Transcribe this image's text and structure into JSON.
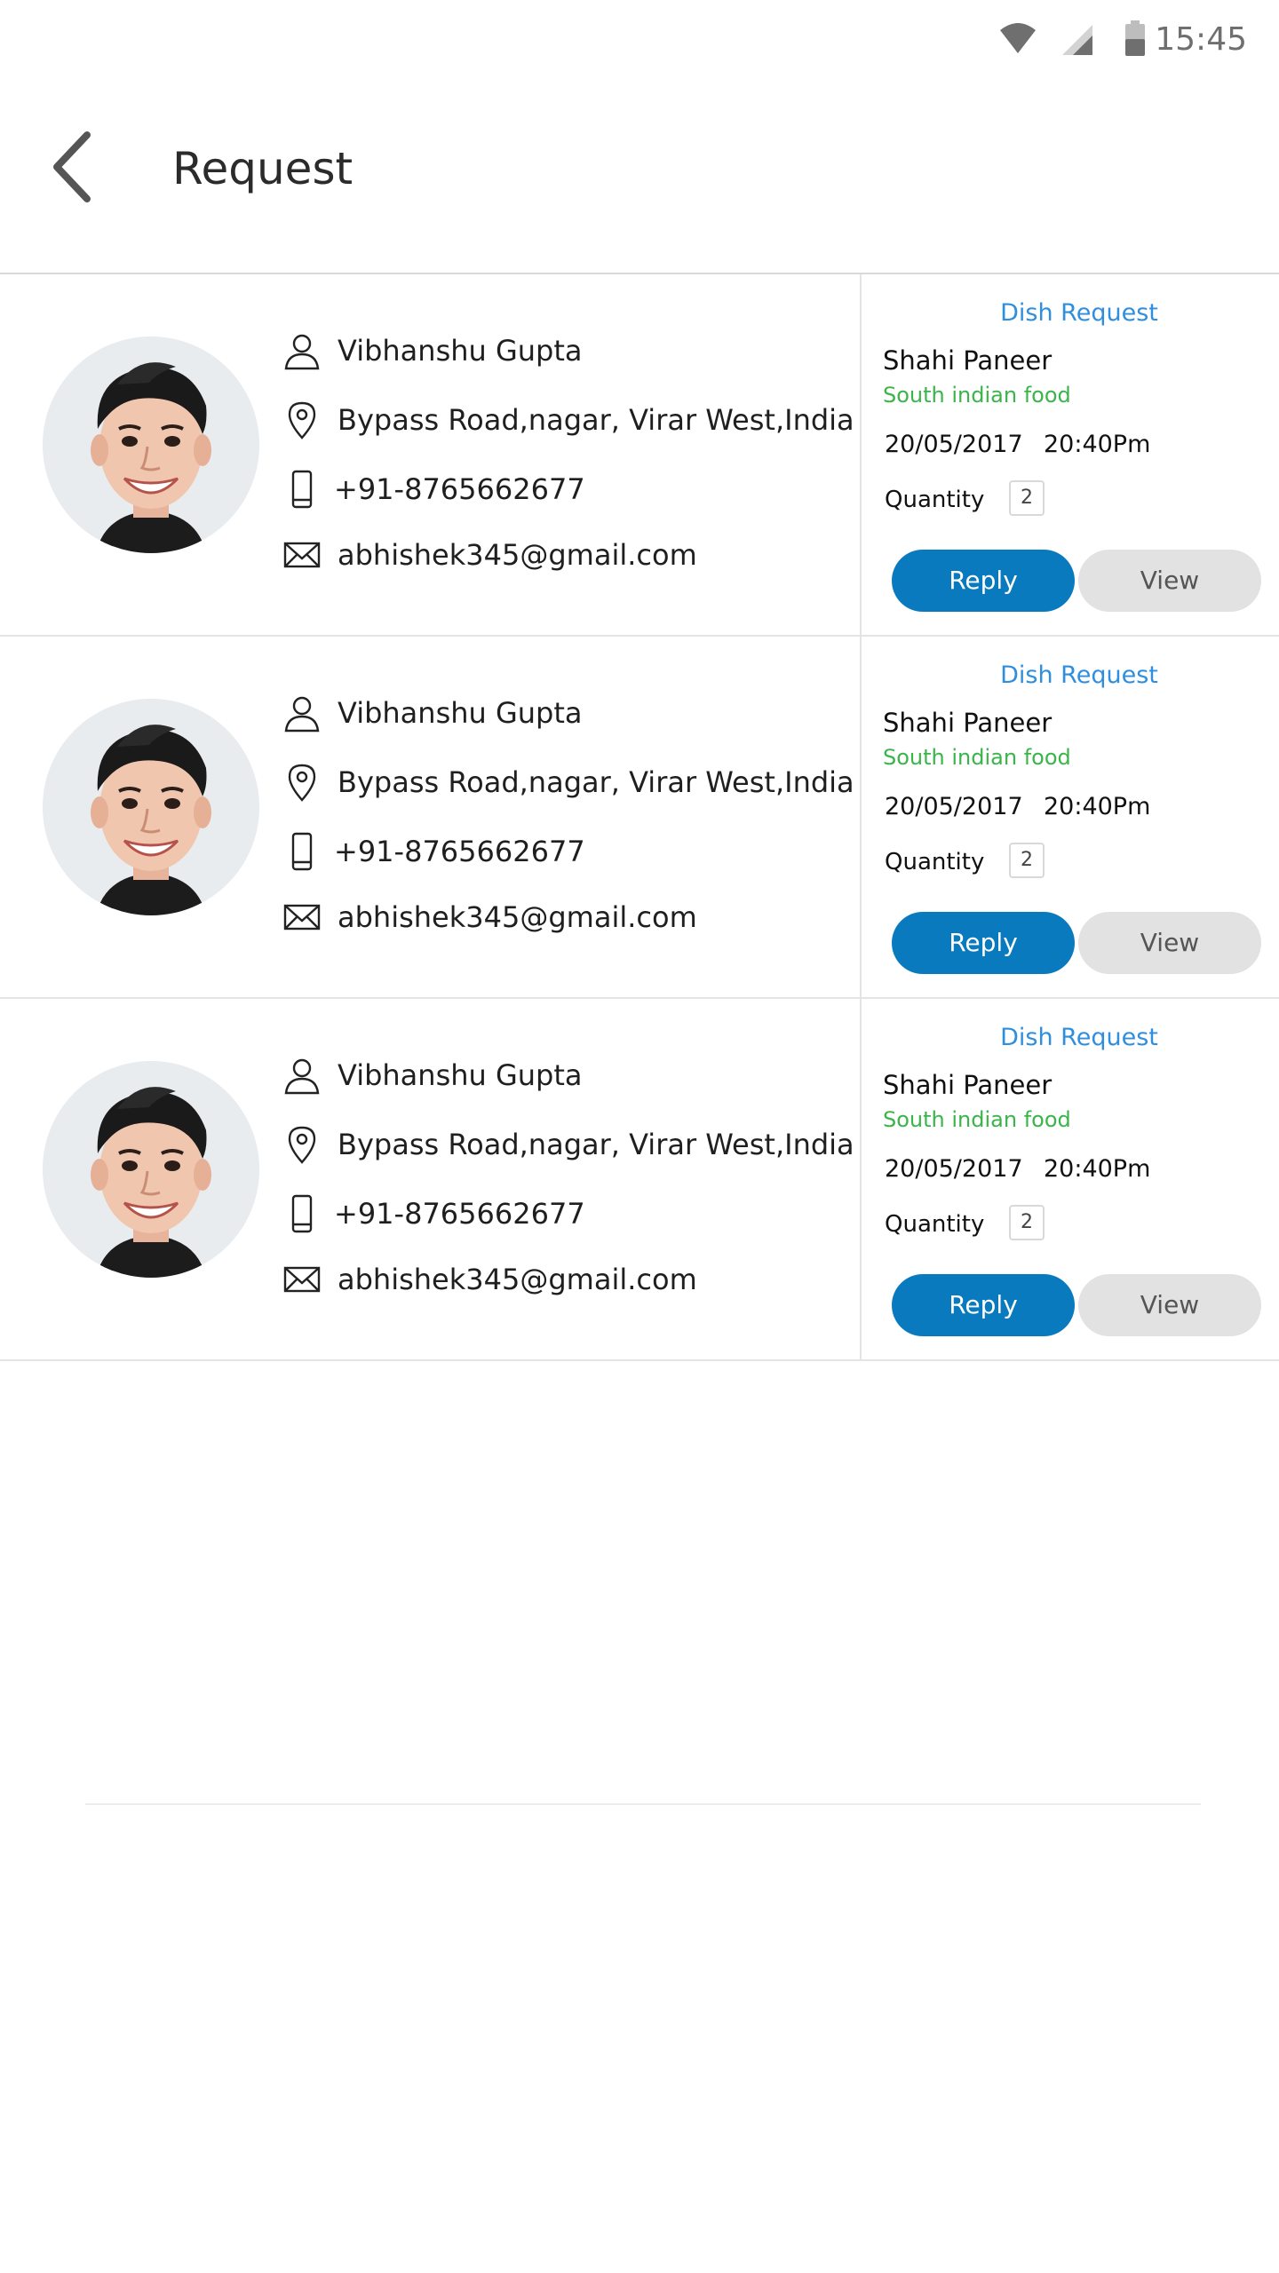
{
  "status_bar": {
    "time": "15:45",
    "icons": [
      "wifi-icon",
      "signal-icon",
      "battery-icon"
    ]
  },
  "app_bar": {
    "title": "Request",
    "back_icon": "back-arrow-icon"
  },
  "colors": {
    "accent": "#0a7abf",
    "link": "#2f8ede",
    "cuisine": "#39b54a",
    "view_button": "#e2e2e2"
  },
  "requests": [
    {
      "name": "Vibhanshu Gupta",
      "address": "Bypass Road,nagar, Virar West,India",
      "phone": "+91-8765662677",
      "email": "abhishek345@gmail.com",
      "request_label": "Dish Request",
      "dish": "Shahi Paneer",
      "cuisine": "South indian food",
      "date": "20/05/2017",
      "time": "20:40Pm",
      "quantity_label": "Quantity",
      "quantity": "2",
      "reply_label": "Reply",
      "view_label": "View"
    },
    {
      "name": "Vibhanshu Gupta",
      "address": "Bypass Road,nagar, Virar West,India",
      "phone": "+91-8765662677",
      "email": "abhishek345@gmail.com",
      "request_label": "Dish Request",
      "dish": "Shahi Paneer",
      "cuisine": "South indian food",
      "date": "20/05/2017",
      "time": "20:40Pm",
      "quantity_label": "Quantity",
      "quantity": "2",
      "reply_label": "Reply",
      "view_label": "View"
    },
    {
      "name": "Vibhanshu Gupta",
      "address": "Bypass Road,nagar, Virar West,India",
      "phone": "+91-8765662677",
      "email": "abhishek345@gmail.com",
      "request_label": "Dish Request",
      "dish": "Shahi Paneer",
      "cuisine": "South indian food",
      "date": "20/05/2017",
      "time": "20:40Pm",
      "quantity_label": "Quantity",
      "quantity": "2",
      "reply_label": "Reply",
      "view_label": "View"
    }
  ]
}
